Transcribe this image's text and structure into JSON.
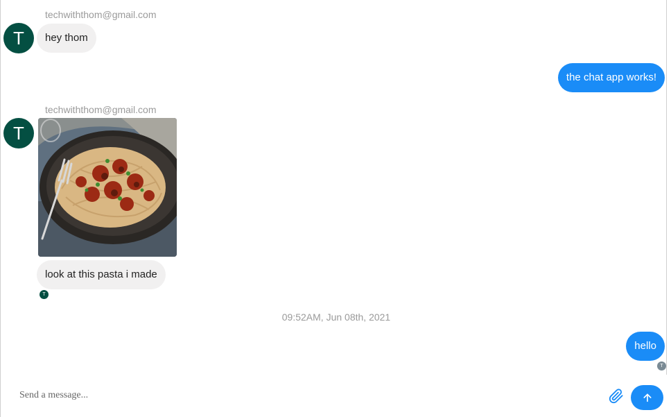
{
  "messages": [
    {
      "sender": "techwiththom@gmail.com",
      "avatar_letter": "T",
      "text": "hey thom"
    },
    {
      "text": "the chat app works!"
    },
    {
      "sender": "techwiththom@gmail.com",
      "avatar_letter": "T",
      "image": "pasta-photo",
      "text": "look at this pasta i made",
      "read_receipt": "T"
    },
    {
      "timestamp": "09:52AM, Jun 08th, 2021"
    },
    {
      "text": "hello",
      "read_receipt": "T"
    }
  ],
  "composer": {
    "placeholder": "Send a message...",
    "attach_icon": "paperclip-icon",
    "send_icon": "arrow-up-icon"
  },
  "colors": {
    "outgoing_bubble": "#1a8cf7",
    "incoming_bubble": "#f1f0f0",
    "avatar": "#044f42",
    "read_receipt_other": "#044f42",
    "read_receipt_self": "#7a8a94"
  }
}
